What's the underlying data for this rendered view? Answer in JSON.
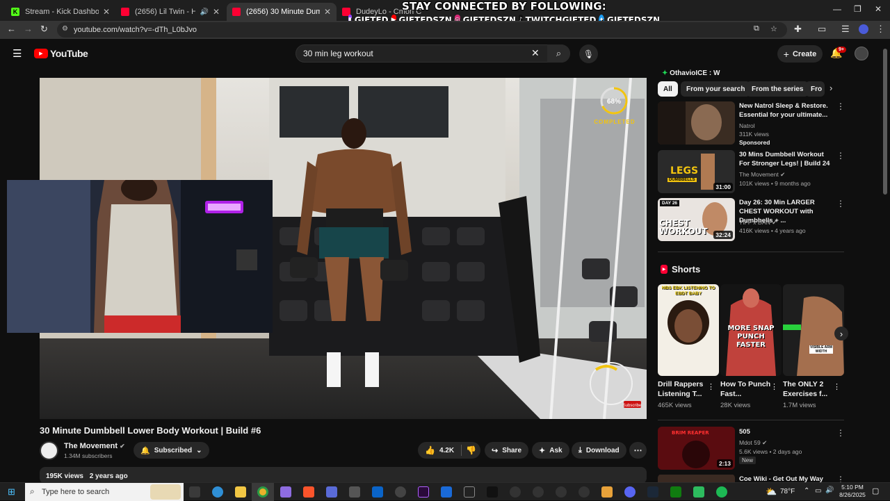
{
  "browser": {
    "tabs": [
      {
        "title": "Stream - Kick Dashboard",
        "color": "#53fc18",
        "active": false
      },
      {
        "title": "(2656) Lil Twin - Hate Being",
        "color": "#ff0033",
        "active": false
      },
      {
        "title": "(2656) 30 Minute Dumbbell Low",
        "color": "#ff0033",
        "active": true
      },
      {
        "title": "DudeyLo - Cmon Cmon (Offici",
        "color": "#ff0033",
        "active": false
      }
    ],
    "url": "youtube.com/watch?v=-dTh_L0bJvo"
  },
  "overlay": {
    "heading": "STAY CONNECTED BY FOLLOWING:",
    "handles": [
      {
        "platform": "twitch",
        "handle": "GIFTED",
        "color": "#9146ff"
      },
      {
        "platform": "youtube",
        "handle": "GIFTEDSZN",
        "color": "#ff0000"
      },
      {
        "platform": "instagram",
        "handle": "GIFTEDSZN",
        "color": "#d62976"
      },
      {
        "platform": "tiktok",
        "handle": "TWITCHGIFTED",
        "color": "#111111"
      },
      {
        "platform": "twitter",
        "handle": "GIFTEDSZN",
        "color": "#1d9bf0"
      }
    ]
  },
  "youtube": {
    "logo_text": "YouTube",
    "search_query": "30 min leg workout",
    "create_label": "Create",
    "notification_count": "9+"
  },
  "video": {
    "progress_ring_label": "68%",
    "progress_fraction": 0.68,
    "completed_label": "COMPLETED",
    "subscribe_sticker": "Subscribe",
    "title": "30 Minute Dumbbell Lower Body Workout | Build #6",
    "channel": "The Movement",
    "subscribers": "1.34M subscribers",
    "subscribed_label": "Subscribed",
    "likes": "4.2K",
    "share_label": "Share",
    "ask_label": "Ask",
    "download_label": "Download",
    "views": "195K views",
    "age": "2 years ago"
  },
  "sidebar": {
    "live_comment": "OthavioICE : W",
    "chips": [
      "All",
      "From your search",
      "From the series",
      "Fro"
    ],
    "recommendations": [
      {
        "title": "New Natrol Sleep & Restore. Essential for your ultimate...",
        "channel": "Natrol",
        "meta": "311K views",
        "badge": "Sponsored",
        "duration": ""
      },
      {
        "title": "30 Mins Dumbbell Workout For Stronger Legs! | Build 24",
        "channel": "The Movement",
        "meta": "101K views • 9 months ago",
        "badge": "",
        "duration": "31:00",
        "thumb_text": "LEGS",
        "thumb_sub": "DUMBBELLS"
      },
      {
        "title": "Day 26: 30 Min LARGER CHEST WORKOUT with Dumbbells + ...",
        "channel": "TIFF x DAN",
        "meta": "416K views • 4 years ago",
        "badge": "",
        "duration": "32:24",
        "thumb_text": "CHEST WORKOUT",
        "thumb_sub": "DAY 26"
      },
      {
        "title": "505",
        "channel": "Mdot 59",
        "meta": "5.6K views • 2 days ago",
        "badge": "New",
        "duration": "2:13",
        "thumb_text": "BRIM REAPER"
      },
      {
        "title": "Coe Wiki - Get Out My Way",
        "channel": "",
        "meta": "",
        "badge": "",
        "duration": ""
      }
    ],
    "shorts_heading": "Shorts",
    "shorts": [
      {
        "title": "Drill Rappers Listening T...",
        "views": "465K views",
        "overlay": "NBS EBK LISTENING TO EBDT BABY"
      },
      {
        "title": "How To Punch Fast...",
        "views": "28K views",
        "overlay": "MORE SNAP PUNCH FASTER"
      },
      {
        "title": "The ONLY 2 Exercises f...",
        "views": "1.7M views",
        "overlay": "VISIBLE ARM WIDTH"
      }
    ]
  },
  "taskbar": {
    "search_placeholder": "Type here to search",
    "weather": "78°F",
    "time": "5:10 PM",
    "date": "8/26/2025"
  }
}
